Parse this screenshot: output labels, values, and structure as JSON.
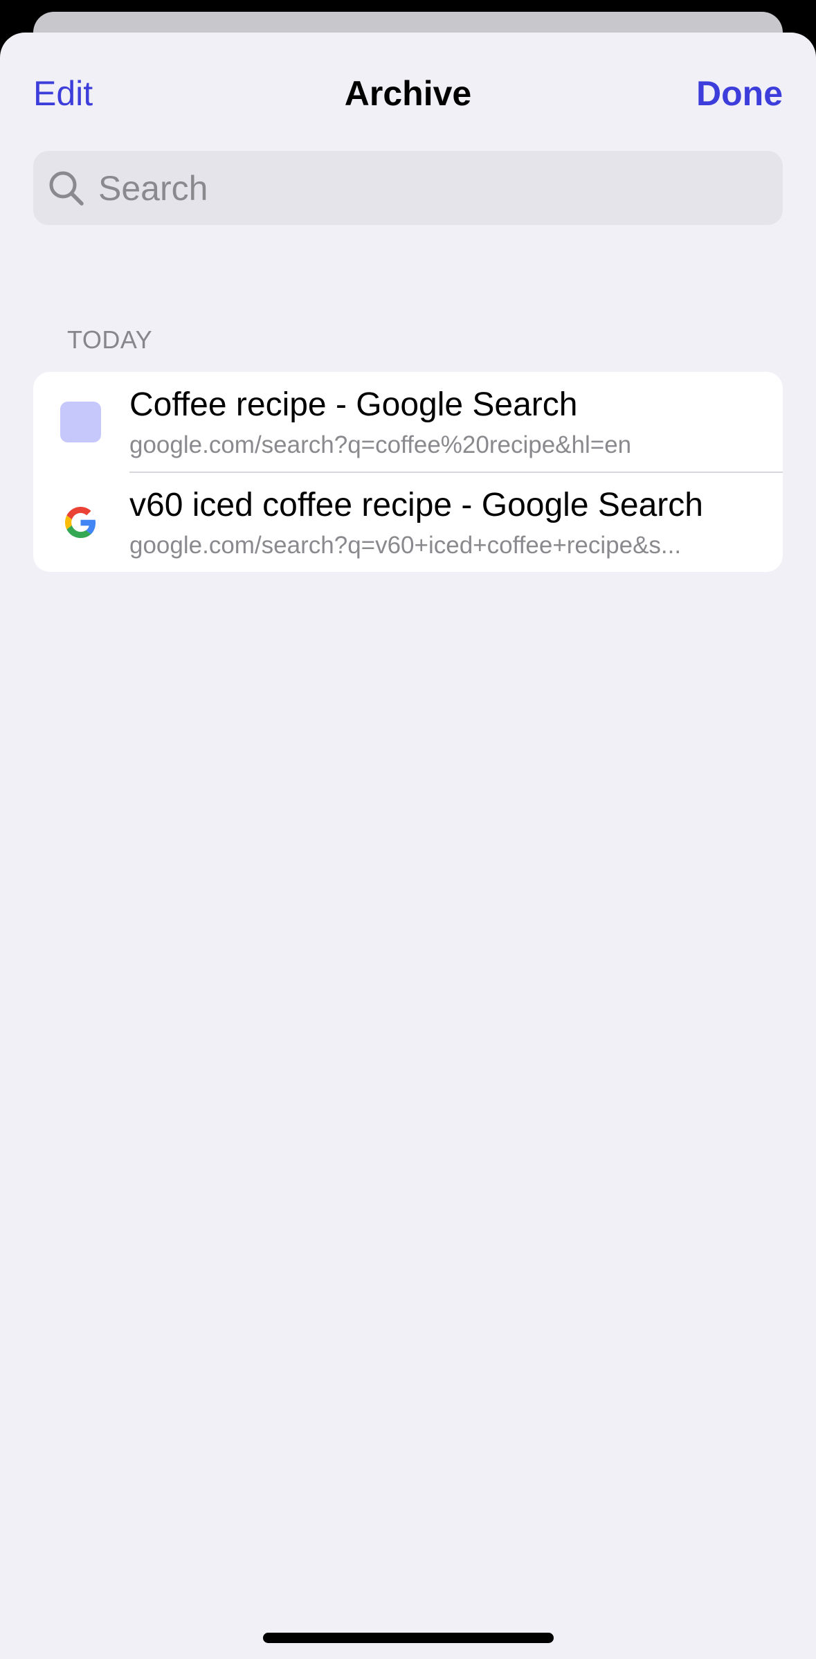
{
  "header": {
    "edit_label": "Edit",
    "title": "Archive",
    "done_label": "Done"
  },
  "search": {
    "placeholder": "Search",
    "icon": "search-icon"
  },
  "section": {
    "label": "TODAY"
  },
  "items": [
    {
      "title": "Coffee recipe - Google Search",
      "url": "google.com/search?q=coffee%20recipe&hl=en",
      "icon": "favicon-placeholder"
    },
    {
      "title": "v60 iced coffee recipe - Google Search",
      "url": "google.com/search?q=v60+iced+coffee+recipe&s...",
      "icon": "google-icon"
    }
  ],
  "colors": {
    "accent": "#3d3ddb",
    "background": "#f0f0f6",
    "placeholder_favicon": "#c6c8fb"
  }
}
